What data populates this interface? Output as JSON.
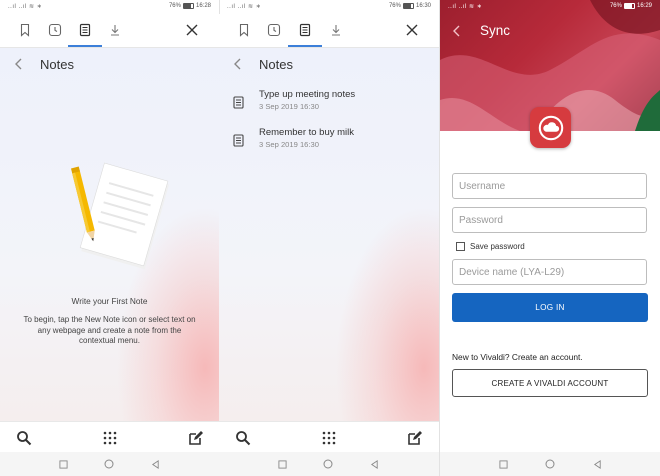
{
  "panel1": {
    "status": {
      "signal": "..ıl ..ıl ≋ ∗",
      "battery": "76%",
      "time": "16:28"
    },
    "header": {
      "title": "Notes"
    },
    "empty": {
      "title": "Write your First Note",
      "body": "To begin, tap the New Note icon or select text on any webpage and create a note from the contextual menu."
    }
  },
  "panel2": {
    "status": {
      "signal": "..ıl ..ıl ≋ ∗",
      "battery": "76%",
      "time": "16:30"
    },
    "header": {
      "title": "Notes"
    },
    "notes": [
      {
        "title": "Type up meeting notes",
        "date": "3 Sep 2019 16:30"
      },
      {
        "title": "Remember to buy milk",
        "date": "3 Sep 2019 16:30"
      }
    ]
  },
  "panel3": {
    "status": {
      "signal": "..ıl ..ıl ≋ ∗",
      "battery": "76%",
      "time": "16:29"
    },
    "header": {
      "title": "Sync"
    },
    "form": {
      "username_placeholder": "Username",
      "password_placeholder": "Password",
      "save_password_label": "Save password",
      "device_name_placeholder": "Device name (LYA-L29)",
      "login_label": "LOG IN"
    },
    "new_account_text": "New to Vivaldi? Create an account.",
    "create_account_label": "CREATE A VIVALDI ACCOUNT"
  },
  "icons": {
    "tabs": [
      "bookmark-icon",
      "history-icon",
      "notes-icon",
      "download-icon"
    ],
    "close": "close-icon",
    "bottom": [
      "search-icon",
      "grid-icon",
      "new-note-icon"
    ],
    "nav": [
      "square-icon",
      "circle-icon",
      "triangle-back-icon"
    ]
  },
  "colors": {
    "accent": "#3c7fd9",
    "login_button": "#1565c0",
    "sync_header": "#b72a3a",
    "app_logo": "#d63b3f",
    "pencil": "#f5b800"
  }
}
